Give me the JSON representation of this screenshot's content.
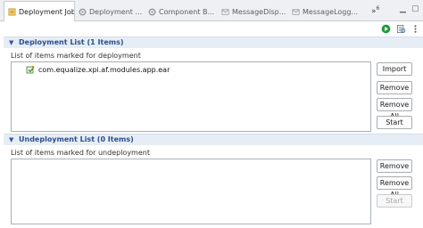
{
  "tabs": [
    {
      "label": "Deployment Job",
      "close": "⨯",
      "active": true,
      "icon": "deployment-job-icon"
    },
    {
      "label": "Deployment ...",
      "active": false,
      "icon": "deployment-icon"
    },
    {
      "label": "Component B...",
      "active": false,
      "icon": "component-icon"
    },
    {
      "label": "MessageDisp...",
      "active": false,
      "icon": "message-icon"
    },
    {
      "label": "MessageLogg...",
      "active": false,
      "icon": "message-icon"
    }
  ],
  "tab_overflow": {
    "label": "»",
    "count": "6"
  },
  "toolbar": {
    "icons": [
      "run-icon",
      "view-icon",
      "menu-icon"
    ]
  },
  "deployment": {
    "title": "Deployment List (1 Items)",
    "caption": "List of items marked for deployment",
    "items": [
      {
        "label": "com.equalize.xpi.af.modules.app.ear",
        "icon": "ear-file-icon"
      }
    ],
    "buttons": {
      "import": "Import",
      "remove": "Remove",
      "remove_all": "Remove All",
      "start": "Start"
    }
  },
  "undeployment": {
    "title": "Undeployment List (0 Items)",
    "caption": "List of items marked for undeployment",
    "items": [],
    "buttons": {
      "remove": "Remove",
      "remove_all": "Remove All",
      "start": "Start"
    }
  },
  "colors": {
    "section_title": "#2a4f8f",
    "section_bg": "#e7edf4",
    "run_green": "#1e9a3c"
  }
}
